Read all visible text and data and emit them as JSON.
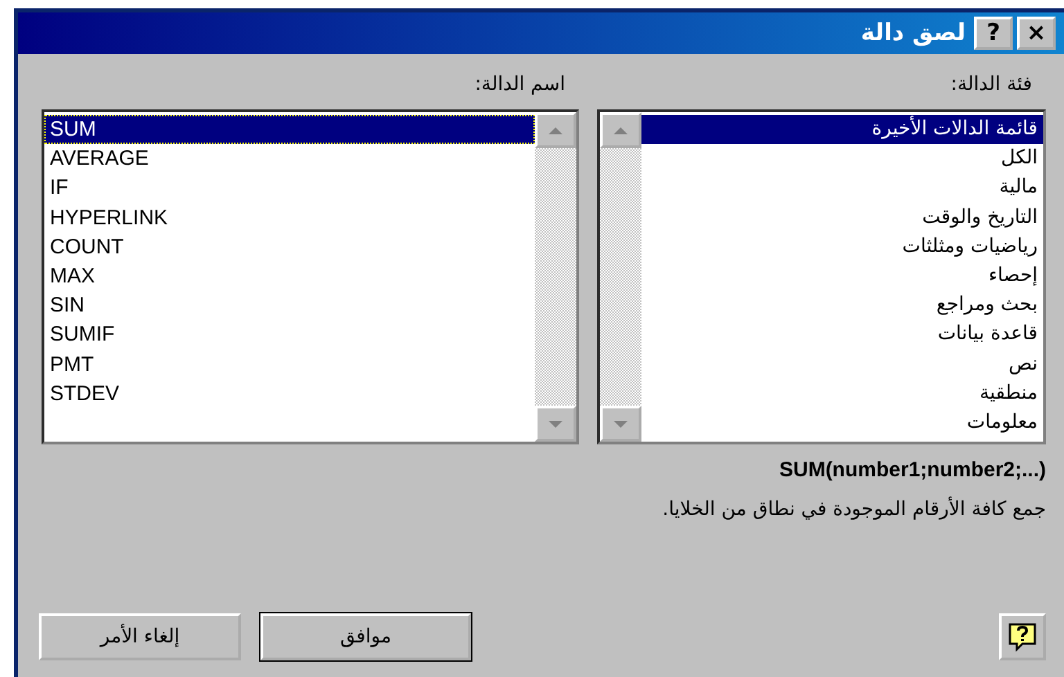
{
  "window": {
    "title": "لصق دالة",
    "title_buttons": [
      "×",
      "?"
    ]
  },
  "category": {
    "label": "فئة الدالة:",
    "items": [
      {
        "label": "قائمة الدالات الأخيرة",
        "selected": true
      },
      {
        "label": "الكل",
        "selected": false
      },
      {
        "label": "مالية",
        "selected": false
      },
      {
        "label": "التاريخ والوقت",
        "selected": false
      },
      {
        "label": "رياضيات ومثلثات",
        "selected": false
      },
      {
        "label": "إحصاء",
        "selected": false
      },
      {
        "label": "بحث ومراجع",
        "selected": false
      },
      {
        "label": "قاعدة بيانات",
        "selected": false
      },
      {
        "label": "نص",
        "selected": false
      },
      {
        "label": "منطقية",
        "selected": false
      },
      {
        "label": "معلومات",
        "selected": false
      }
    ]
  },
  "function_name": {
    "label": "اسم الدالة:",
    "items": [
      {
        "label": "SUM",
        "selected": true
      },
      {
        "label": "AVERAGE",
        "selected": false
      },
      {
        "label": "IF",
        "selected": false
      },
      {
        "label": "HYPERLINK",
        "selected": false
      },
      {
        "label": "COUNT",
        "selected": false
      },
      {
        "label": "MAX",
        "selected": false
      },
      {
        "label": "SIN",
        "selected": false
      },
      {
        "label": "SUMIF",
        "selected": false
      },
      {
        "label": "PMT",
        "selected": false
      },
      {
        "label": "STDEV",
        "selected": false
      }
    ]
  },
  "signature": "SUM(number1;number2;...)",
  "description": "جمع كافة الأرقام الموجودة في نطاق من الخلايا.",
  "buttons": [
    {
      "label": "موافق",
      "kind": "default"
    },
    {
      "label": "إلغاء الأمر",
      "kind": "normal"
    }
  ]
}
